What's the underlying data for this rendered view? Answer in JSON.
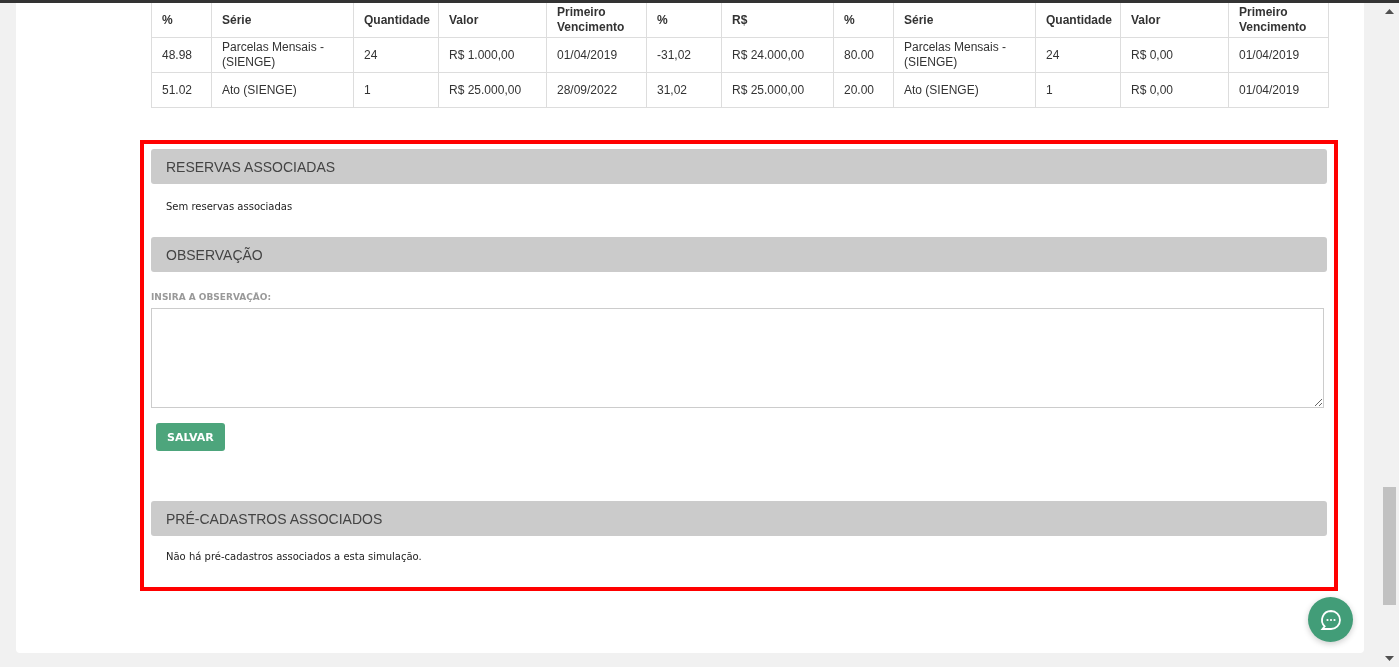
{
  "table": {
    "columns": [
      "%",
      "Série",
      "Quantidade",
      "Valor",
      "Primeiro Vencimento",
      "%",
      "R$",
      "%",
      "Série",
      "Quantidade",
      "Valor",
      "Primeiro Vencimento"
    ],
    "rows": [
      [
        "48.98",
        "Parcelas Mensais - (SIENGE)",
        "24",
        "R$ 1.000,00",
        "01/04/2019",
        "-31,02",
        "R$ 24.000,00",
        "80.00",
        "Parcelas Mensais - (SIENGE)",
        "24",
        "R$ 0,00",
        "01/04/2019"
      ],
      [
        "51.02",
        "Ato (SIENGE)",
        "1",
        "R$ 25.000,00",
        "28/09/2022",
        "31,02",
        "R$ 25.000,00",
        "20.00",
        "Ato (SIENGE)",
        "1",
        "R$ 0,00",
        "01/04/2019"
      ]
    ]
  },
  "reservas": {
    "title": "RESERVAS ASSOCIADAS",
    "message": "Sem reservas associadas"
  },
  "observacao": {
    "title": "OBSERVAÇÃO",
    "label": "INSIRA A OBSERVAÇÃO:",
    "save_button": "SALVAR"
  },
  "pre_cadastros": {
    "title": "PRÉ-CADASTROS ASSOCIADOS",
    "message": "Não há pré-cadastros associados a esta simulação."
  }
}
